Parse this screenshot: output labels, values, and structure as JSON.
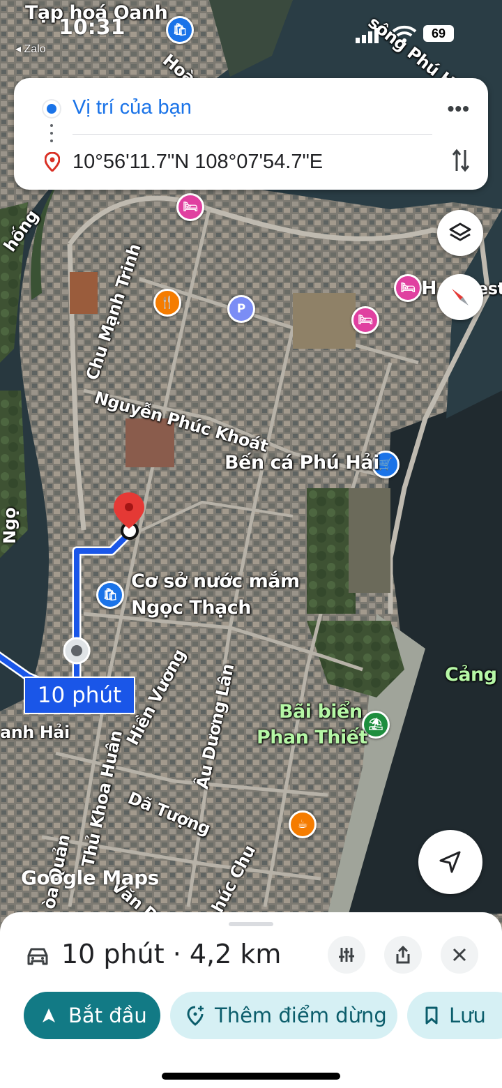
{
  "status_bar": {
    "time": "10:31",
    "back_app": "◂ Zalo",
    "battery": "69"
  },
  "route_card": {
    "origin": "Vị trí của bạn",
    "destination": "10°56'11.7\"N 108°07'54.7\"E",
    "more_label": "•••"
  },
  "map": {
    "labels": {
      "tap_hoa": "Tạp hoá Oanh",
      "hoang": "Hoàn",
      "song_phu_hai": "sông Phú Hả",
      "hong": "hống",
      "chu_manh_trinh": "Chu Mạnh Trinh",
      "nguyen_phuc_khoat": "Nguyễn Phúc Khoát",
      "ben_ca": "Bến cá Phú Hải",
      "co_so_line1": "Cơ sở nước mắm",
      "co_so_line2": "Ngọc Thạch",
      "hien_vuong": "Hiền Vương",
      "au_duong_lan": "Âu Dương Lân",
      "da_tuong": "Dã Tượng",
      "bai_bien_line1": "Bãi biển",
      "bai_bien_line2": "Phan Thiết",
      "cang": "Cảng",
      "thanh_hai": "anh Hải",
      "thu_khoa_huan": "Thủ Khoa Huân",
      "van_duc": "Văn Dũ",
      "phuc_chu": "húc Chu",
      "quan": "òa Quản",
      "h_rest": "H",
      "rest_suffix": "est",
      "ngo": "Ngọ"
    },
    "eta_badge": "10 phút",
    "attribution": "Google Maps",
    "route_color": "#1a56e8"
  },
  "sheet": {
    "summary": "10 phút · 4,2 km",
    "start": "Bắt đầu",
    "add_stop": "Thêm điểm dừng",
    "save": "Lưu"
  }
}
